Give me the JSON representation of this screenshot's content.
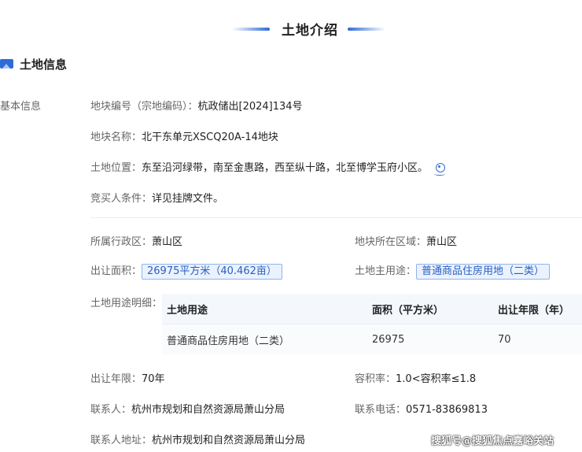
{
  "header": {
    "title": "土地介绍"
  },
  "section": {
    "title": "土地信息",
    "side_label": "基本信息"
  },
  "info": {
    "parcel_no": {
      "label": "地块编号（宗地编码）：",
      "value": "杭政储出[2024]134号"
    },
    "parcel_name": {
      "label": "地块名称：",
      "value": "北干东单元XSCQ20A-14地块"
    },
    "location": {
      "label": "土地位置：",
      "value": "东至沿河绿带，南至金惠路，西至纵十路，北至博学玉府小区。"
    },
    "bidder": {
      "label": "竞买人条件：",
      "value": "详见挂牌文件。"
    }
  },
  "details": {
    "district": {
      "label": "所属行政区：",
      "value": "萧山区"
    },
    "region": {
      "label": "地块所在区域：",
      "value": "萧山区"
    },
    "area": {
      "label": "出让面积：",
      "value": "26975平方米（40.462亩）"
    },
    "use": {
      "label": "土地主用途：",
      "value": "普通商品住房用地（二类）"
    },
    "usage_detail_label": "土地用途明细：",
    "table": {
      "headers": [
        "土地用途",
        "面积（平方米）",
        "出让年限（年）"
      ],
      "rows": [
        [
          "普通商品住房用地（二类）",
          "26975",
          "70"
        ]
      ]
    },
    "term": {
      "label": "出让年限：",
      "value": "70年"
    },
    "far": {
      "label": "容积率：",
      "value": "1.0<容积率≤1.8"
    },
    "contact": {
      "label": "联系人：",
      "value": "杭州市规划和自然资源局萧山分局"
    },
    "phone": {
      "label": "联系电话：",
      "value": "0571-83869813"
    },
    "address": {
      "label": "联系人地址：",
      "value": "杭州市规划和自然资源局萧山分局"
    }
  },
  "watermark": "搜狐号@搜狐焦点嘉峪关站",
  "colors": {
    "accent": "#2f6bd6"
  },
  "icons": {
    "section": "image-icon",
    "location": "location-pin-icon"
  }
}
